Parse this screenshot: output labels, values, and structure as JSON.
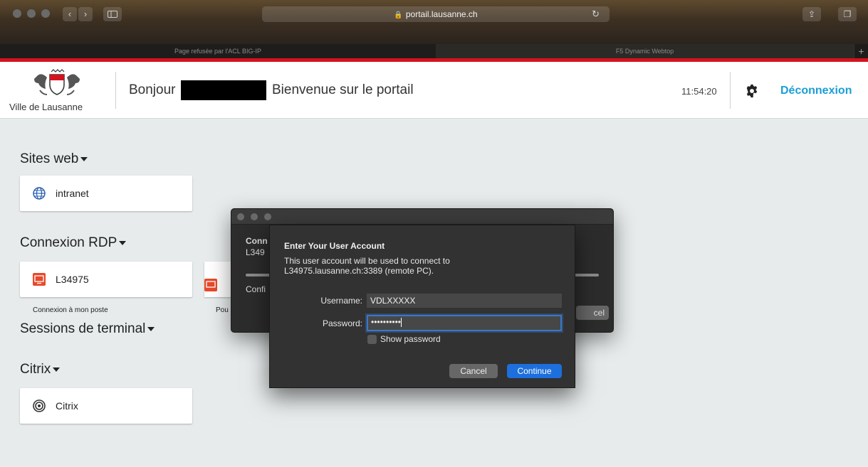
{
  "browser": {
    "url": "portail.lausanne.ch",
    "tabs": [
      {
        "label": "Page refusée par l'ACL BIG-IP",
        "active": false
      },
      {
        "label": "F5 Dynamic Webtop",
        "active": true
      }
    ]
  },
  "header": {
    "logo_text": "Ville de Lausanne",
    "greeting": "Bonjour",
    "welcome": "Bienvenue sur le portail",
    "clock": "11:54:20",
    "logout_label": "Déconnexion"
  },
  "sections": {
    "sites_web": {
      "title": "Sites web",
      "items": [
        "intranet"
      ]
    },
    "rdp": {
      "title": "Connexion RDP",
      "items": [
        "L34975"
      ],
      "caption": "Connexion à mon poste",
      "caption2": "Pou"
    },
    "terminal": {
      "title": "Sessions de terminal"
    },
    "citrix": {
      "title": "Citrix",
      "items": [
        "Citrix"
      ]
    }
  },
  "back_dialog": {
    "line1": "Conn",
    "line2": "L349",
    "line3": "Confi",
    "button_fragment": "cel"
  },
  "login_sheet": {
    "title": "Enter Your User Account",
    "description_line1": "This user account will be used to connect to",
    "description_line2": "L34975.lausanne.ch:3389 (remote PC).",
    "username_label": "Username:",
    "username_value": "VDLXXXXX",
    "password_label": "Password:",
    "password_value": "••••••••••",
    "show_password_label": "Show password",
    "cancel_label": "Cancel",
    "continue_label": "Continue"
  },
  "colors": {
    "accent": "#1a9ed7",
    "brand_red": "#d4121e",
    "primary_button": "#1d6fdc"
  }
}
